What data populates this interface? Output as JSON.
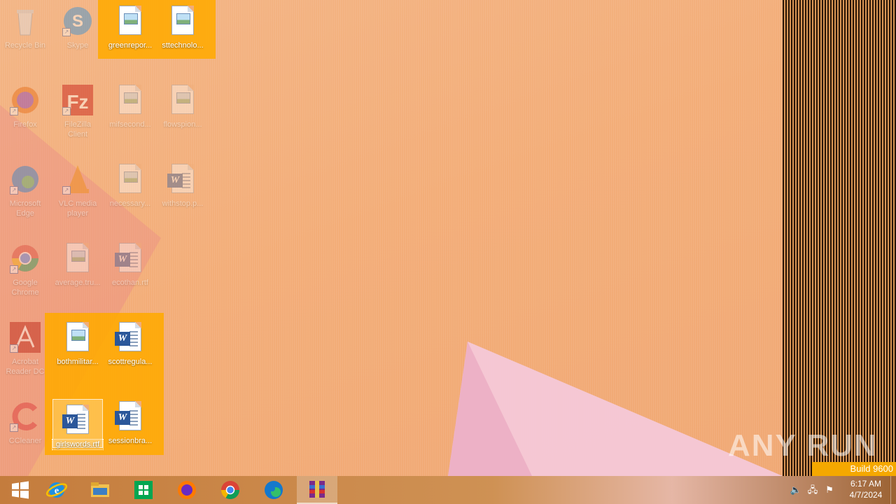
{
  "desktop": {
    "icons": [
      {
        "label": "Recycle Bin",
        "icon": "recycle-bin-icon"
      },
      {
        "label": "Skype",
        "icon": "skype-icon"
      },
      {
        "label": "greenrepor...",
        "icon": "image-file-icon"
      },
      {
        "label": "sttechnolo...",
        "icon": "image-file-icon"
      },
      {
        "label": "Firefox",
        "icon": "firefox-icon"
      },
      {
        "label": "FileZilla Client",
        "icon": "filezilla-icon"
      },
      {
        "label": "mifsecond...",
        "icon": "image-file-icon"
      },
      {
        "label": "flowspion...",
        "icon": "image-file-icon"
      },
      {
        "label": "Microsoft Edge",
        "icon": "edge-icon"
      },
      {
        "label": "VLC media player",
        "icon": "vlc-icon"
      },
      {
        "label": "necessary...",
        "icon": "image-file-icon"
      },
      {
        "label": "withstop.p...",
        "icon": "word-doc-icon"
      },
      {
        "label": "Google Chrome",
        "icon": "chrome-icon"
      },
      {
        "label": "average.tru...",
        "icon": "image-file-icon"
      },
      {
        "label": "ecothan.rtf",
        "icon": "word-doc-icon"
      },
      {
        "label": "Acrobat Reader DC",
        "icon": "acrobat-icon"
      },
      {
        "label": "bothmilitar...",
        "icon": "image-file-icon"
      },
      {
        "label": "scottregula...",
        "icon": "word-doc-icon"
      },
      {
        "label": "CCleaner",
        "icon": "ccleaner-icon"
      },
      {
        "label": "girlswords.rtf",
        "icon": "word-doc-icon"
      },
      {
        "label": "sessionbra...",
        "icon": "word-doc-icon"
      }
    ]
  },
  "watermark": "ANY RUN",
  "build_badge": "Build 9600",
  "taskbar": {
    "buttons": [
      {
        "name": "start-button",
        "icon": "windows-logo-icon"
      },
      {
        "name": "internet-explorer",
        "icon": "ie-icon"
      },
      {
        "name": "file-explorer",
        "icon": "folder-icon"
      },
      {
        "name": "store",
        "icon": "store-icon"
      },
      {
        "name": "firefox",
        "icon": "firefox-icon"
      },
      {
        "name": "chrome",
        "icon": "chrome-icon"
      },
      {
        "name": "edge",
        "icon": "edge-icon"
      },
      {
        "name": "winrar",
        "icon": "winrar-icon"
      }
    ],
    "tray": [
      "volume-icon",
      "network-icon",
      "action-center-flag-icon"
    ],
    "clock": {
      "time": "6:17 AM",
      "date": "4/7/2024"
    }
  },
  "colors": {
    "selection": "#ffaa00",
    "desktop": "#f3b585",
    "accent": "#f5a800"
  }
}
